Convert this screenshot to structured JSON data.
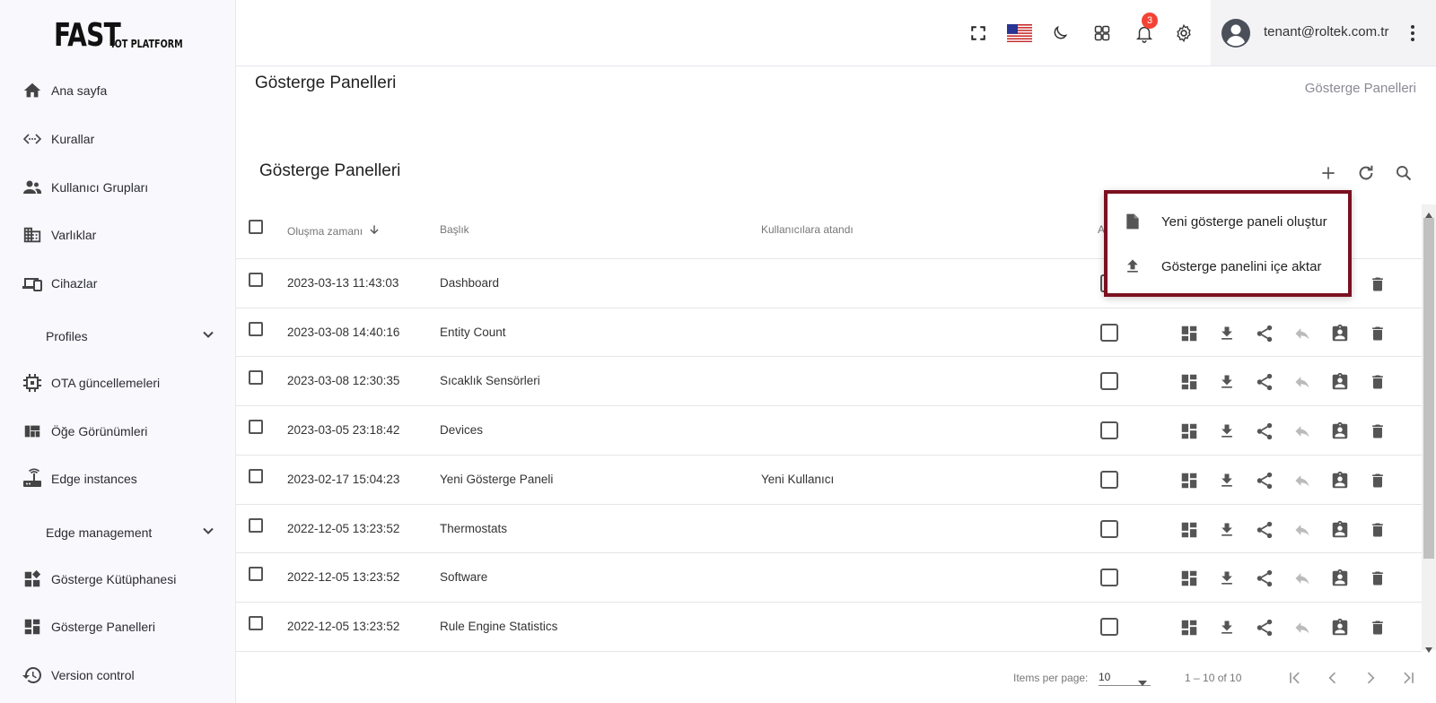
{
  "logo": {
    "big": "FAST",
    "small": "IOT PLATFORM"
  },
  "sidebar": {
    "items": [
      {
        "label": "Ana sayfa",
        "icon": "home-icon"
      },
      {
        "label": "Kurallar",
        "icon": "code-icon"
      },
      {
        "label": "Kullanıcı Grupları",
        "icon": "people-icon"
      },
      {
        "label": "Varlıklar",
        "icon": "domain-icon"
      },
      {
        "label": "Cihazlar",
        "icon": "devices-icon"
      },
      {
        "label": "Profiles",
        "icon": "chevron-down-icon"
      },
      {
        "label": "OTA güncellemeleri",
        "icon": "memory-icon"
      },
      {
        "label": "Öğe Görünümleri",
        "icon": "view-quilt-icon"
      },
      {
        "label": "Edge instances",
        "icon": "router-icon"
      },
      {
        "label": "Edge management",
        "icon": "chevron-down-icon"
      },
      {
        "label": "Gösterge Kütüphanesi",
        "icon": "widgets-icon"
      },
      {
        "label": "Gösterge Panelleri",
        "icon": "dashboard-icon"
      },
      {
        "label": "Version control",
        "icon": "history-icon"
      }
    ]
  },
  "topbar": {
    "notification_count": "3",
    "user_email": "tenant@roltek.com.tr",
    "flag": "us-flag-icon"
  },
  "page": {
    "title": "Gösterge Panelleri",
    "breadcrumb": "Gösterge Panelleri",
    "card_title": "Gösterge Panelleri"
  },
  "table": {
    "headers": {
      "created": "Oluşma zamanı",
      "title": "Başlık",
      "assigned": "Kullanıcılara atandı",
      "public": "A"
    },
    "rows": [
      {
        "created": "2023-03-13 11:43:03",
        "title": "Dashboard",
        "assigned": ""
      },
      {
        "created": "2023-03-08 14:40:16",
        "title": "Entity Count",
        "assigned": ""
      },
      {
        "created": "2023-03-08 12:30:35",
        "title": "Sıcaklık Sensörleri",
        "assigned": ""
      },
      {
        "created": "2023-03-05 23:18:42",
        "title": "Devices",
        "assigned": ""
      },
      {
        "created": "2023-02-17 15:04:23",
        "title": "Yeni Gösterge Paneli",
        "assigned": "Yeni Kullanıcı"
      },
      {
        "created": "2022-12-05 13:23:52",
        "title": "Thermostats",
        "assigned": ""
      },
      {
        "created": "2022-12-05 13:23:52",
        "title": "Software",
        "assigned": ""
      },
      {
        "created": "2022-12-05 13:23:52",
        "title": "Rule Engine Statistics",
        "assigned": ""
      }
    ]
  },
  "paginator": {
    "items_per_page_label": "Items per page:",
    "page_size": "10",
    "range": "1 – 10 of 10"
  },
  "menu": {
    "create_label": "Yeni gösterge paneli oluştur",
    "import_label": "Gösterge panelini içe aktar"
  },
  "colors": {
    "menu_border": "#7b1020",
    "badge": "#f44336",
    "icon": "#555555"
  }
}
